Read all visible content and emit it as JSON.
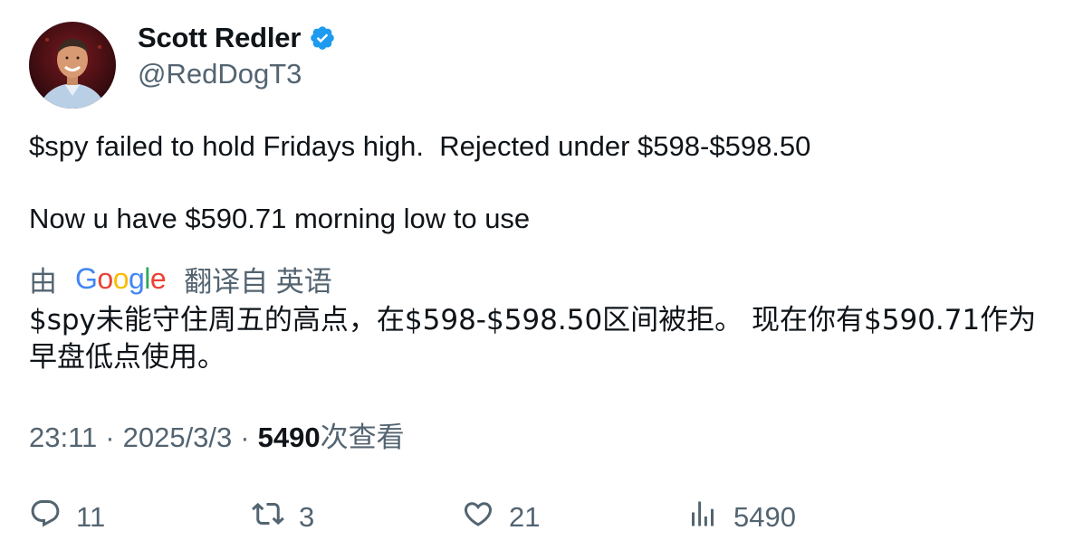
{
  "author": {
    "name": "Scott Redler",
    "handle": "@RedDogT3",
    "verified_icon": "verified-badge-icon",
    "verified_color": "#1d9bf0"
  },
  "tweet": {
    "line1": "$spy failed to hold Fridays high.  Rejected under $598-$598.50",
    "line2": "Now u have $590.71 morning low to use"
  },
  "translation": {
    "prefix": "由",
    "provider": "Google",
    "suffix": "翻译自 英语",
    "text": "$spy未能守住周五的高点，在$598-$598.50区间被拒。 现在你有$590.71作为早盘低点使用。"
  },
  "meta": {
    "time": "23:11",
    "separator": "·",
    "date": "2025/3/3",
    "views_count": "5490",
    "views_label": "次查看"
  },
  "actions": {
    "replies": "11",
    "retweets": "3",
    "likes": "21",
    "views": "5490"
  },
  "colors": {
    "text_primary": "#0f1419",
    "text_secondary": "#536471",
    "accent": "#1d9bf0"
  }
}
